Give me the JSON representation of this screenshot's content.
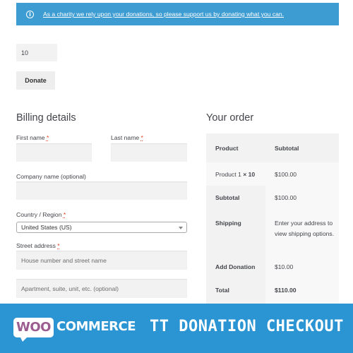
{
  "notice": {
    "icon": "info-icon",
    "message": "As a charity we rely upon your donations, so please support us by donating what you can."
  },
  "donation": {
    "amount_value": "10",
    "donate_label": "Donate"
  },
  "billing": {
    "title": "Billing details",
    "first_name_label": "First name",
    "last_name_label": "Last name",
    "company_label": "Company name (optional)",
    "country_label": "Country / Region",
    "country_value": "United States (US)",
    "street_label": "Street address",
    "street_placeholder": "House number and street name",
    "street2_placeholder": "Apartment, suite, unit, etc. (optional)",
    "required_mark": "*"
  },
  "order": {
    "title": "Your order",
    "header": {
      "product": "Product",
      "subtotal": "Subtotal"
    },
    "item": {
      "name": "Product 1",
      "qty": "× 10",
      "price": "$100.00"
    },
    "subtotal": {
      "label": "Subtotal",
      "value": "$100.00"
    },
    "shipping": {
      "label": "Shipping",
      "value": "Enter your address to view shipping options."
    },
    "add_donation": {
      "label": "Add Donation",
      "value": "$10.00"
    },
    "total": {
      "label": "Total",
      "value": "$110.00"
    }
  },
  "banner": {
    "logo_woo": "WOO",
    "logo_commerce": "COMMERCE",
    "title": "TT DONATION CHECKOUT"
  },
  "colors": {
    "notice_bg": "#3d9cd2",
    "banner_bg": "#2b94d3",
    "woo_purple": "#9b5c8f",
    "required_red": "#e2401c"
  }
}
